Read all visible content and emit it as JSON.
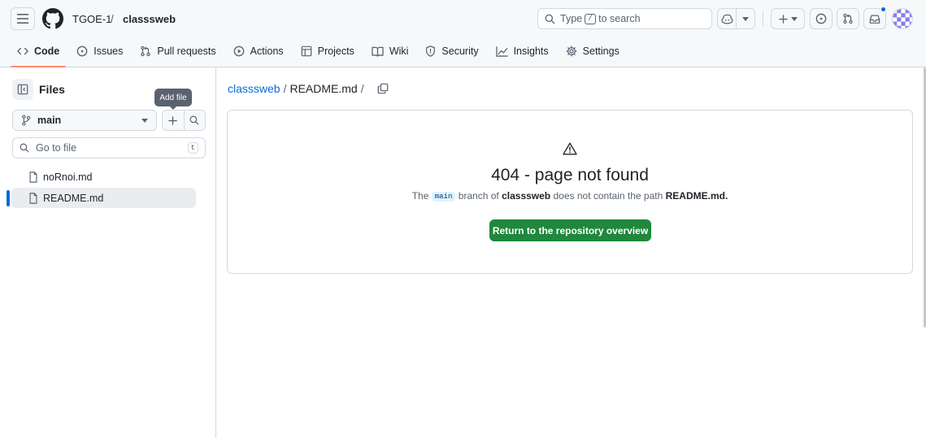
{
  "header": {
    "owner": "TGOE-1",
    "separator": "/",
    "repo": "classsweb",
    "search": {
      "before": "Type",
      "key": "/",
      "after": "to search"
    }
  },
  "tabs": [
    {
      "label": "Code",
      "icon": "code-icon",
      "active": true
    },
    {
      "label": "Issues",
      "icon": "issue-opened-icon"
    },
    {
      "label": "Pull requests",
      "icon": "git-pull-request-icon"
    },
    {
      "label": "Actions",
      "icon": "play-icon"
    },
    {
      "label": "Projects",
      "icon": "table-icon"
    },
    {
      "label": "Wiki",
      "icon": "book-icon"
    },
    {
      "label": "Security",
      "icon": "shield-icon"
    },
    {
      "label": "Insights",
      "icon": "graph-icon"
    },
    {
      "label": "Settings",
      "icon": "gear-icon"
    }
  ],
  "sidebar": {
    "title": "Files",
    "tooltip": "Add file",
    "branch": "main",
    "goto_placeholder": "Go to file",
    "goto_key": "t",
    "files": [
      {
        "name": "noRnoi.md",
        "selected": false
      },
      {
        "name": "README.md",
        "selected": true
      }
    ]
  },
  "main": {
    "breadcrumb": {
      "repo": "classsweb",
      "sep": "/",
      "file": "README.md",
      "trail": "/"
    },
    "error_title": "404 - page not found",
    "desc": {
      "prefix": "The",
      "branch": "main",
      "middle": "branch of",
      "repo": "classsweb",
      "middle2": "does not contain the path",
      "path": "README.md."
    },
    "return_button": "Return to the repository overview"
  },
  "colors": {
    "accent": "#0969da",
    "tab_underline": "#fd8c73",
    "success_button": "#1f883d"
  }
}
